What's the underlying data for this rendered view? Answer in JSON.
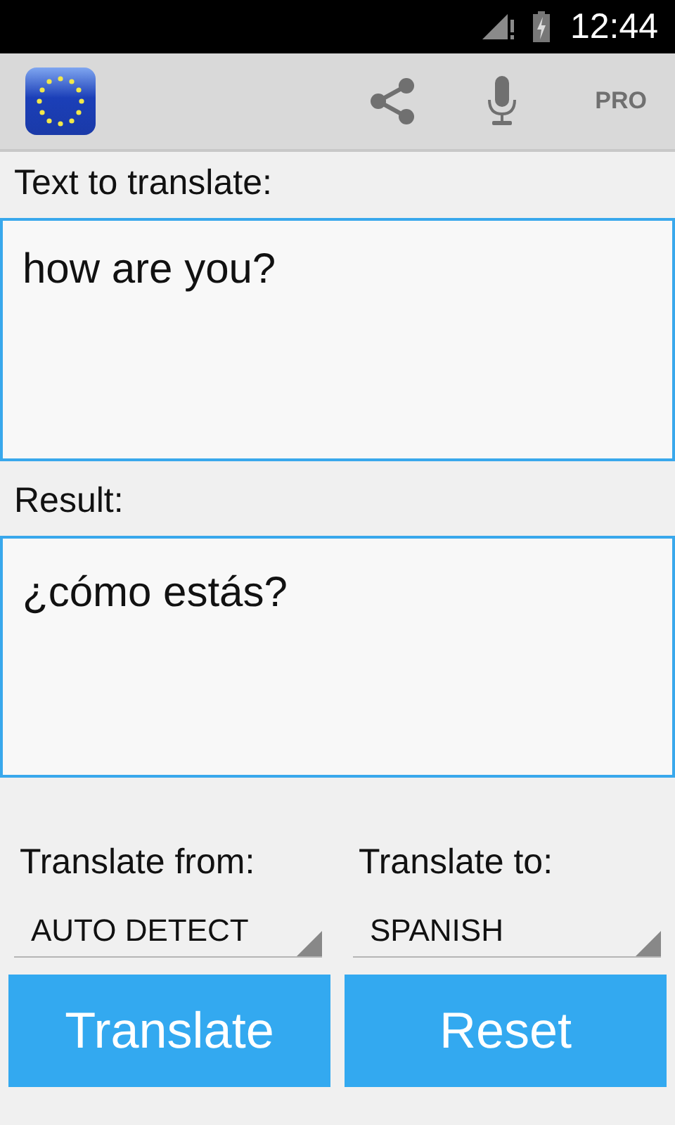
{
  "status_bar": {
    "time": "12:44"
  },
  "app_bar": {
    "action": "PRO"
  },
  "input": {
    "label": "Text to translate:",
    "value": "how are you?"
  },
  "result": {
    "label": "Result:",
    "text": "¿cómo estás?"
  },
  "languages": [
    {
      "label": "Translate from:",
      "value": "AUTO DETECT"
    },
    {
      "label": "Translate to:",
      "value": "SPANISH"
    }
  ],
  "buttons": [
    "Translate",
    "Reset"
  ]
}
